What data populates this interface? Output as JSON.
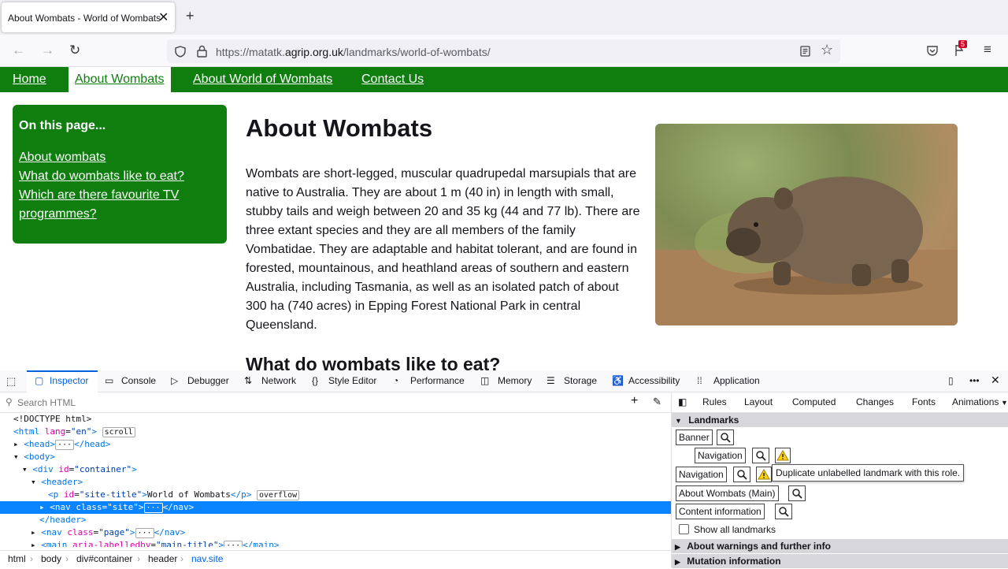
{
  "browser": {
    "tab_title": "About Wombats - World of Wombats",
    "url_prefix": "https://matatk.",
    "url_domain": "agrip.org.uk",
    "url_path": "/landmarks/world-of-wombats/",
    "notification_count": "5"
  },
  "site": {
    "nav": [
      "Home",
      "About Wombats",
      "About World of Wombats",
      "Contact Us"
    ],
    "on_this_page_title": "On this page...",
    "on_this_page_links": [
      "About wombats",
      "What do wombats like to eat?",
      "Which are there favourite TV",
      "programmes?"
    ],
    "heading": "About Wombats",
    "paragraph_lines": [
      "Wombats are short-legged, muscular quadrupedal marsupials that are",
      "native to Australia. They are about 1 m (40 in) in length with small,",
      "stubby tails and weigh between 20 and 35 kg (44 and 77 lb). There are",
      "three extant species and they are all members of the family",
      "Vombatidae. They are adaptable and habitat tolerant, and are found in",
      "forested, mountainous, and heathland areas of southern and eastern",
      "Australia, including Tasmania, as well as an isolated patch of about",
      "300 ha (740 acres) in Epping Forest National Park in central",
      "Queensland."
    ],
    "subheading": "What do wombats like to eat?"
  },
  "devtools": {
    "tabs": [
      "Inspector",
      "Console",
      "Debugger",
      "Network",
      "Style Editor",
      "Performance",
      "Memory",
      "Storage",
      "Accessibility",
      "Application"
    ],
    "search_placeholder": "Search HTML",
    "markup": {
      "doctype": "<!DOCTYPE html>",
      "scroll_badge": "scroll",
      "overflow_badge": "overflow",
      "site_title_text": "World of Wombats"
    },
    "breadcrumbs": [
      "html",
      "body",
      "div#container",
      "header",
      "nav.site"
    ],
    "side_tabs": [
      "Rules",
      "Layout",
      "Computed",
      "Changes",
      "Fonts",
      "Animations"
    ],
    "landmarks_header": "Landmarks",
    "landmarks": [
      "Banner",
      "Navigation",
      "Navigation",
      "About Wombats (Main)",
      "Content information"
    ],
    "tooltip": "Duplicate unlabelled landmark with this role.",
    "show_all_label": "Show all landmarks",
    "warnings_header": "About warnings and further info",
    "mutation_header": "Mutation information"
  }
}
